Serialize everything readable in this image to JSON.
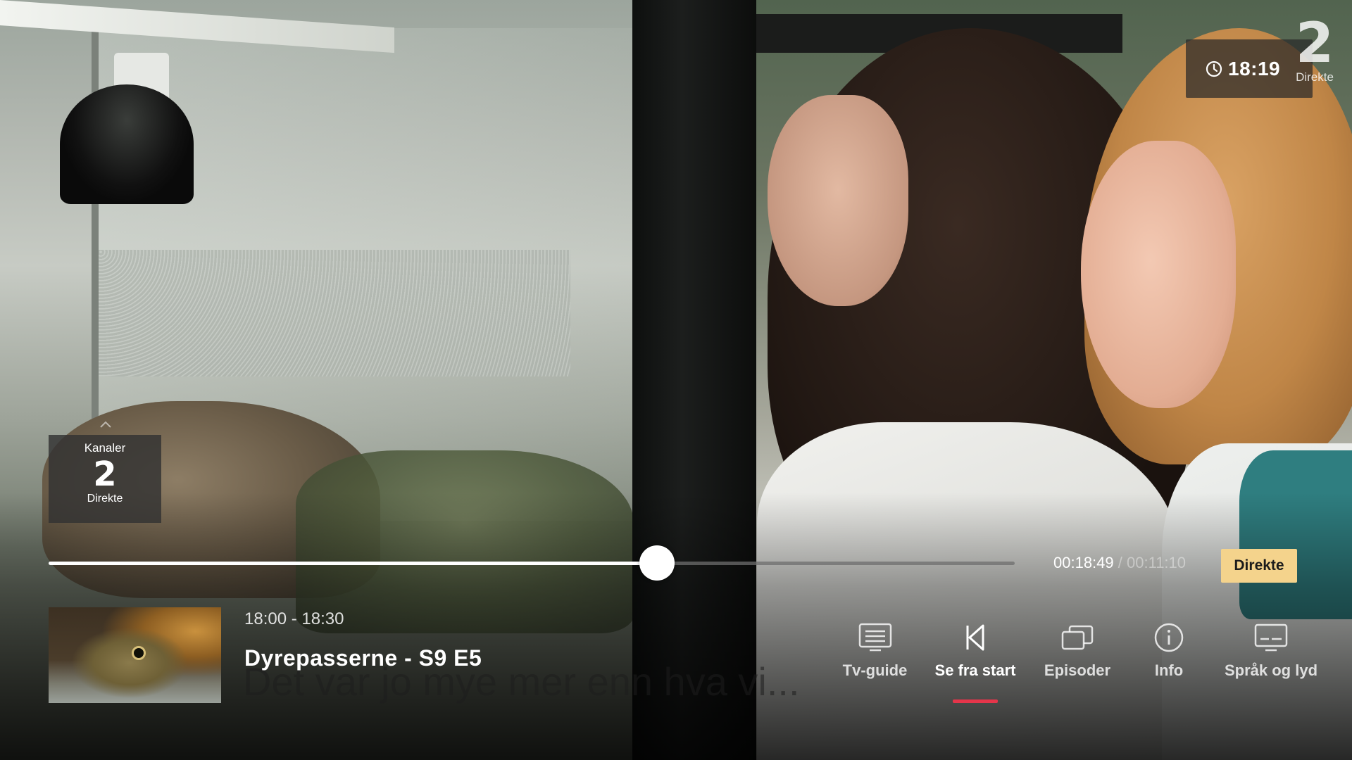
{
  "clock": {
    "time": "18:19",
    "icon": "clock-icon"
  },
  "channel_logo": {
    "number": "2",
    "label": "Direkte"
  },
  "channels": {
    "label": "Kanaler",
    "number": "2",
    "status": "Direkte",
    "icon": "chevron-up-icon"
  },
  "player": {
    "progress_fraction": 0.63,
    "current_time": "00:18:49",
    "separator": "/",
    "total_time": "00:11:10",
    "live_button_label": "Direkte",
    "live_button_color": "#f4d38c"
  },
  "program": {
    "time_range": "18:00 - 18:30",
    "title": "Dyrepasserne - S9 E5",
    "subtitle_text": "Det var jo mye mer enn hva vi..."
  },
  "menu": {
    "active_color": "#e5354a",
    "items": [
      {
        "label": "Tv-guide",
        "icon": "tv-guide-icon",
        "active": false
      },
      {
        "label": "Se fra start",
        "icon": "skip-to-start-icon",
        "active": true
      },
      {
        "label": "Episoder",
        "icon": "episodes-icon",
        "active": false
      },
      {
        "label": "Info",
        "icon": "info-icon",
        "active": false
      },
      {
        "label": "Språk og lyd",
        "icon": "subtitles-audio-icon",
        "active": false
      }
    ]
  }
}
